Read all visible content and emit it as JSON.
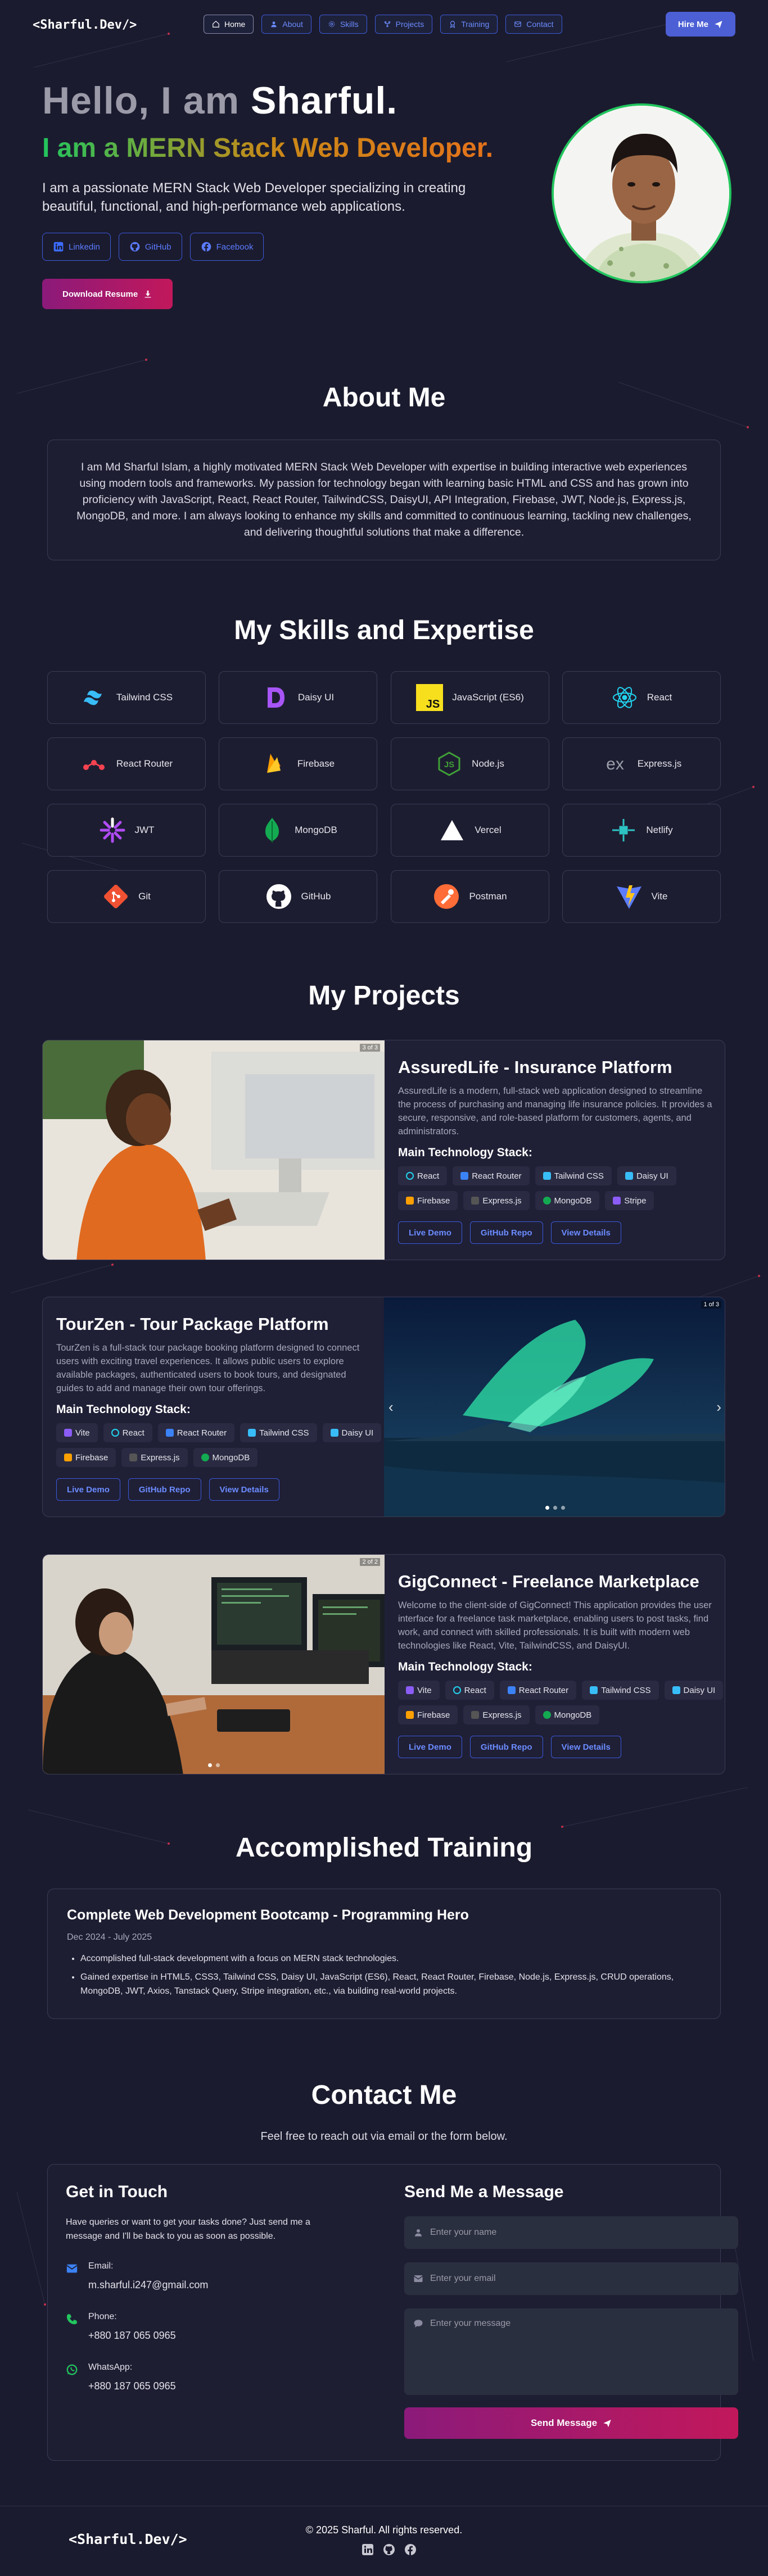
{
  "nav": {
    "logo": "<Sharful.Dev/>",
    "links": [
      {
        "label": "Home",
        "icon": "home-icon",
        "active": true
      },
      {
        "label": "About",
        "icon": "user-icon",
        "active": false
      },
      {
        "label": "Skills",
        "icon": "gear-icon",
        "active": false
      },
      {
        "label": "Projects",
        "icon": "projects-icon",
        "active": false
      },
      {
        "label": "Training",
        "icon": "training-icon",
        "active": false
      },
      {
        "label": "Contact",
        "icon": "mail-icon",
        "active": false
      }
    ],
    "hire_label": "Hire Me"
  },
  "hero": {
    "hello_prefix": "Hello, I am",
    "hello_name": "Sharful.",
    "role": "I am a MERN Stack Web Developer.",
    "description": "I am a passionate MERN Stack Web Developer specializing in creating beautiful, functional, and high-performance web applications.",
    "socials": [
      "Linkedin",
      "GitHub",
      "Facebook"
    ],
    "resume_label": "Download Resume"
  },
  "about": {
    "title": "About Me",
    "text": "I am Md Sharful Islam, a highly motivated MERN Stack Web Developer with expertise in building interactive web experiences using modern tools and frameworks. My passion for technology began with learning basic HTML and CSS and has grown into proficiency with JavaScript, React, React Router, TailwindCSS, DaisyUI, API Integration, Firebase, JWT, Node.js, Express.js, MongoDB, and more. I am always looking to enhance my skills and committed to continuous learning, tackling new challenges, and delivering thoughtful solutions that make a difference."
  },
  "skills": {
    "title": "My Skills and Expertise",
    "items": [
      "Tailwind CSS",
      "Daisy UI",
      "JavaScript (ES6)",
      "React",
      "React Router",
      "Firebase",
      "Node.js",
      "Express.js",
      "JWT",
      "MongoDB",
      "Vercel",
      "Netlify",
      "Git",
      "GitHub",
      "Postman",
      "Vite"
    ]
  },
  "projects": {
    "title": "My Projects",
    "stack_label": "Main Technology Stack:",
    "buttons": [
      "Live Demo",
      "GitHub Repo",
      "View Details"
    ],
    "items": [
      {
        "title": "AssuredLife - Insurance Platform",
        "description": "AssuredLife is a modern, full-stack web application designed to streamline the process of purchasing and managing life insurance policies. It provides a secure, responsive, and role-based platform for customers, agents, and administrators.",
        "counter": "3 of 3",
        "tags": [
          "React",
          "React Router",
          "Tailwind CSS",
          "Daisy UI",
          "Firebase",
          "Express.js",
          "MongoDB",
          "Stripe"
        ]
      },
      {
        "title": "TourZen - Tour Package Platform",
        "description": "TourZen is a full-stack tour package booking platform designed to connect users with exciting travel experiences. It allows public users to explore available packages, authenticated users to book tours, and designated guides to add and manage their own tour offerings.",
        "counter": "1 of 3",
        "tags": [
          "Vite",
          "React",
          "React Router",
          "Tailwind CSS",
          "Daisy UI",
          "Firebase",
          "Express.js",
          "MongoDB"
        ]
      },
      {
        "title": "GigConnect - Freelance Marketplace",
        "description": "Welcome to the client-side of GigConnect! This application provides the user interface for a freelance task marketplace, enabling users to post tasks, find work, and connect with skilled professionals. It is built with modern web technologies like React, Vite, TailwindCSS, and DaisyUI.",
        "counter": "2 of 2",
        "tags": [
          "Vite",
          "React",
          "React Router",
          "Tailwind CSS",
          "Daisy UI",
          "Firebase",
          "Express.js",
          "MongoDB"
        ]
      }
    ]
  },
  "training": {
    "title": "Accomplished Training",
    "course": "Complete Web Development Bootcamp - Programming Hero",
    "date": "Dec 2024 - July 2025",
    "points": [
      "Accomplished full-stack development with a focus on MERN stack technologies.",
      "Gained expertise in HTML5, CSS3, Tailwind CSS, Daisy UI, JavaScript (ES6), React, React Router, Firebase, Node.js, Express.js, CRUD operations, MongoDB, JWT, Axios, Tanstack Query, Stripe integration, etc., via building real-world projects."
    ]
  },
  "contact": {
    "title": "Contact Me",
    "subtitle": "Feel free to reach out via email or the form below.",
    "get_in_touch": "Get in Touch",
    "get_in_touch_desc": "Have queries or want to get your tasks done? Just send me a message and I'll be back to you as soon as possible.",
    "email_label": "Email:",
    "email": "m.sharful.i247@gmail.com",
    "phone_label": "Phone:",
    "phone": "+880 187 065 0965",
    "whatsapp_label": "WhatsApp:",
    "whatsapp": "+880 187 065 0965",
    "form_title": "Send Me a Message",
    "name_placeholder": "Enter your name",
    "email_placeholder": "Enter your email",
    "message_placeholder": "Enter your message",
    "send_label": "Send Message"
  },
  "footer": {
    "logo": "<Sharful.Dev/>",
    "copyright": "© 2025 Sharful. All rights reserved."
  },
  "colors": {
    "background": "#1b1b2f",
    "accent": "#3b5bdb",
    "green": "#22c55e",
    "gradient_start": "#8b1a7a",
    "gradient_end": "#c2185b"
  }
}
